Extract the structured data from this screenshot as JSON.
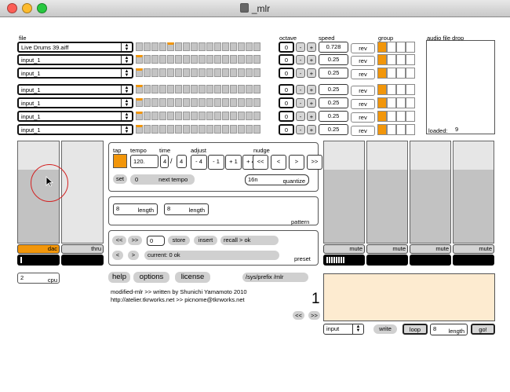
{
  "window": {
    "title": "_mlr"
  },
  "headers": {
    "file": "file",
    "octave": "octave",
    "speed": "speed",
    "group": "group",
    "audio_drop": "audio file drop"
  },
  "rows": [
    {
      "file": "Live Drums 39.aiff",
      "octave": "0",
      "speed": "0.728",
      "rev": "rev",
      "pos": 4
    },
    {
      "file": "input_1",
      "octave": "0",
      "speed": "0.25",
      "rev": "rev",
      "pos": 0
    },
    {
      "file": "input_1",
      "octave": "0",
      "speed": "0.25",
      "rev": "rev",
      "pos": 0
    },
    {
      "file": "input_1",
      "octave": "0",
      "speed": "0.25",
      "rev": "rev",
      "pos": 0
    },
    {
      "file": "input_1",
      "octave": "0",
      "speed": "0.25",
      "rev": "rev",
      "pos": 0
    },
    {
      "file": "input_1",
      "octave": "0",
      "speed": "0.25",
      "rev": "rev",
      "pos": 0
    },
    {
      "file": "input_1",
      "octave": "0",
      "speed": "0.25",
      "rev": "rev",
      "pos": 0
    }
  ],
  "minus": "-",
  "plus": "+",
  "loaded": {
    "label": "loaded:",
    "value": "9"
  },
  "tempo": {
    "tap": "tap",
    "tempo_label": "tempo",
    "time_label": "time",
    "adjust_label": "adjust",
    "nudge_label": "nudge",
    "tempo_value": "120.",
    "time_num": "4",
    "slash": "/",
    "time_den": "4",
    "adjust": [
      "- 4",
      "- 1",
      "+ 1",
      "+ 4"
    ],
    "nudge": [
      "<<",
      "<",
      ">",
      ">>"
    ],
    "set": "set",
    "next_value": "0",
    "next_label": "next tempo",
    "quantize_value": "16n",
    "quantize_label": "quantize"
  },
  "pattern": {
    "len1": "8",
    "len2": "8",
    "length_label": "length",
    "label": "pattern"
  },
  "preset": {
    "prev_fast": "<<",
    "next_fast": ">>",
    "num": "0",
    "store": "store",
    "insert": "insert",
    "recall": "recall > ok",
    "prev": "<",
    "next": ">",
    "current": "current: 0 ok",
    "label": "preset"
  },
  "left": {
    "dac": "dac",
    "thru": "thru",
    "cpu_value": "2",
    "cpu_label": "cpu",
    "dac_level": 0.72
  },
  "help": {
    "help": "help",
    "options": "options",
    "license": "license",
    "prefix": "/sys/prefix /mlr"
  },
  "credits": {
    "line1": "modified-mlr >> written by Shunichi Yamamoto  2010",
    "line2": "http://atelier.tkrworks.net >> picnome@tkrworks.net"
  },
  "mutes": {
    "label": "mute",
    "levels": [
      0.72,
      0.72,
      0.72,
      0.72
    ]
  },
  "record": {
    "number": "1",
    "prev": "<<",
    "next": ">>",
    "input": "input",
    "write": "write",
    "loop": "loop",
    "len_value": "8",
    "len_label": "length",
    "go": "go!"
  }
}
